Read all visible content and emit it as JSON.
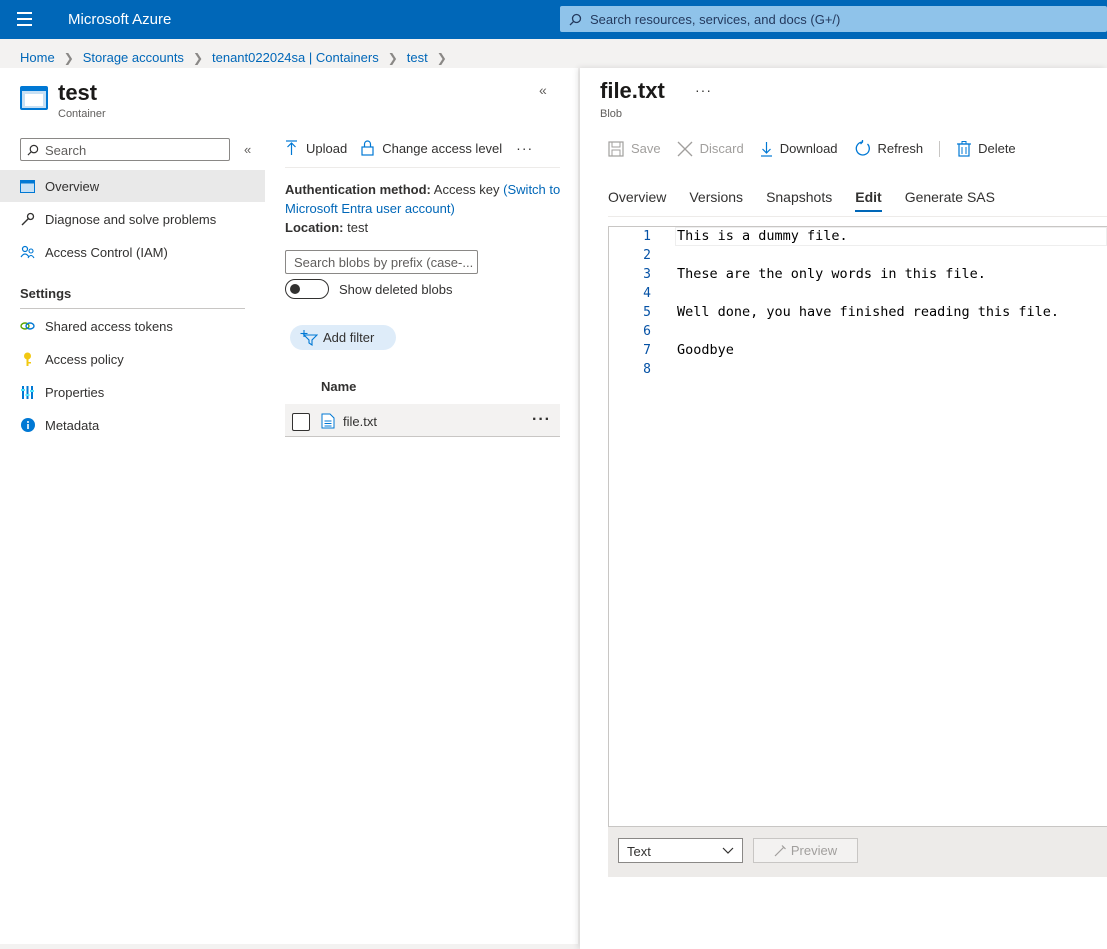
{
  "topbar": {
    "brand": "Microsoft Azure",
    "search_placeholder": "Search resources, services, and docs (G+/)"
  },
  "breadcrumb": [
    "Home",
    "Storage accounts",
    "tenant022024sa | Containers",
    "test"
  ],
  "left_blade": {
    "title": "test",
    "subtitle": "Container",
    "search_placeholder": "Search",
    "nav": [
      {
        "label": "Overview",
        "icon": "overview-icon",
        "active": true
      },
      {
        "label": "Diagnose and solve problems",
        "icon": "wrench-icon"
      },
      {
        "label": "Access Control (IAM)",
        "icon": "people-icon"
      }
    ],
    "settings_heading": "Settings",
    "settings": [
      {
        "label": "Shared access tokens",
        "icon": "link-icon"
      },
      {
        "label": "Access policy",
        "icon": "key-icon"
      },
      {
        "label": "Properties",
        "icon": "sliders-icon"
      },
      {
        "label": "Metadata",
        "icon": "info-icon"
      }
    ]
  },
  "container_pane": {
    "toolbar": {
      "upload": "Upload",
      "change_access": "Change access level"
    },
    "auth_label": "Authentication method:",
    "auth_value": "Access key",
    "auth_link": "(Switch to Microsoft Entra user account)",
    "location_label": "Location:",
    "location_value": "test",
    "blob_search_placeholder": "Search blobs by prefix (case-...",
    "show_deleted": "Show deleted blobs",
    "add_filter": "Add filter",
    "column_name": "Name",
    "rows": [
      {
        "name": "file.txt"
      }
    ]
  },
  "blob_blade": {
    "title": "file.txt",
    "subtitle": "Blob",
    "toolbar": {
      "save": "Save",
      "discard": "Discard",
      "download": "Download",
      "refresh": "Refresh",
      "delete": "Delete"
    },
    "tabs": [
      {
        "label": "Overview"
      },
      {
        "label": "Versions"
      },
      {
        "label": "Snapshots"
      },
      {
        "label": "Edit",
        "active": true
      },
      {
        "label": "Generate SAS"
      }
    ],
    "editor_lines": [
      "This is a dummy file.",
      "",
      "These are the only words in this file.",
      "",
      "Well done, you have finished reading this file.",
      "",
      "Goodbye",
      ""
    ],
    "line_numbers": [
      "1",
      "2",
      "3",
      "4",
      "5",
      "6",
      "7",
      "8"
    ],
    "format_select": "Text",
    "preview": "Preview"
  },
  "colors": {
    "azure_blue": "#0067b8",
    "link": "#0067b8"
  }
}
